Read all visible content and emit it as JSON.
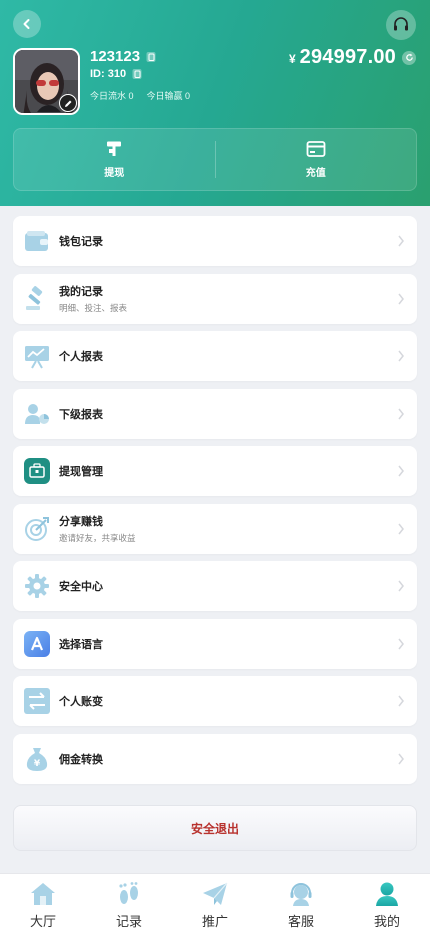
{
  "header": {
    "username": "123123",
    "user_id_label": "ID: 310",
    "today_flow": "今日流水 0",
    "today_win": "今日输赢 0",
    "currency_symbol": "¥",
    "balance": "294997.00",
    "actions": [
      {
        "label": "提现",
        "icon": "withdraw-icon"
      },
      {
        "label": "充值",
        "icon": "recharge-icon"
      }
    ]
  },
  "menu": {
    "items": [
      {
        "title": "钱包记录",
        "icon": "wallet-icon"
      },
      {
        "title": "我的记录",
        "subtitle": "明细、投注、报表",
        "icon": "gavel-icon"
      },
      {
        "title": "个人报表",
        "icon": "chart-board-icon"
      },
      {
        "title": "下级报表",
        "icon": "user-chart-icon"
      },
      {
        "title": "提现管理",
        "icon": "briefcase-icon"
      },
      {
        "title": "分享赚钱",
        "subtitle": "邀请好友，共享收益",
        "icon": "target-icon"
      },
      {
        "title": "安全中心",
        "icon": "gear-icon"
      },
      {
        "title": "选择语言",
        "icon": "language-icon"
      },
      {
        "title": "个人账变",
        "icon": "transfer-icon"
      },
      {
        "title": "佣金转换",
        "icon": "money-bag-icon"
      }
    ]
  },
  "logout_label": "安全退出",
  "tabbar": {
    "tabs": [
      {
        "label": "大厅",
        "icon": "home-icon",
        "active": false
      },
      {
        "label": "记录",
        "icon": "footprint-icon",
        "active": false
      },
      {
        "label": "推广",
        "icon": "paper-plane-icon",
        "active": false
      },
      {
        "label": "客服",
        "icon": "support-agent-icon",
        "active": false
      },
      {
        "label": "我的",
        "icon": "user-icon",
        "active": true
      }
    ]
  },
  "colors": {
    "header_start": "#2fb9a6",
    "header_end": "#2aa06f",
    "logout_text": "#b8322e",
    "icon_light": "#a9d4e6",
    "active_tab": "#1fb6b0"
  }
}
